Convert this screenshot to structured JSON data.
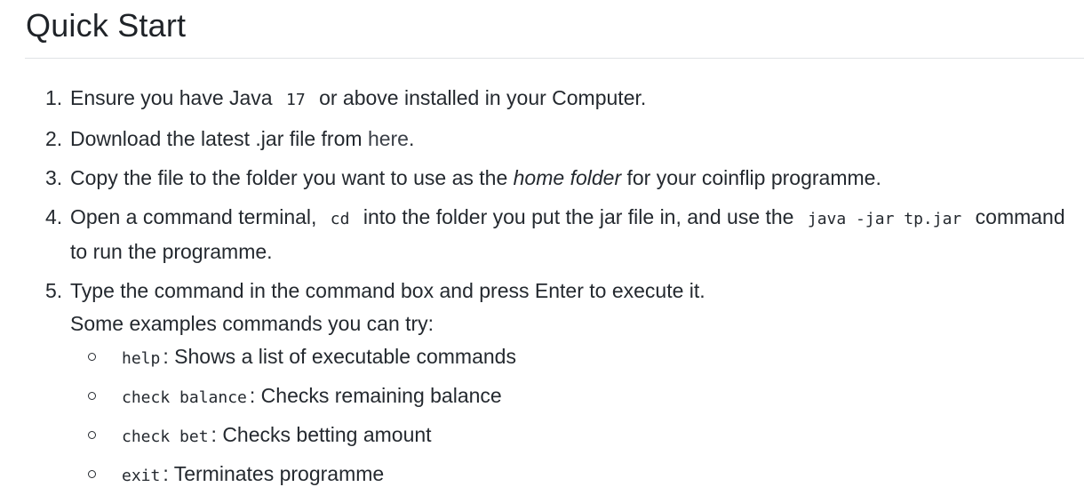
{
  "heading": "Quick Start",
  "steps": [
    {
      "num": "1.",
      "pre": "Ensure you have Java",
      "code": "17",
      "post": "or above installed in your Computer."
    },
    {
      "num": "2.",
      "pre": "Download the latest .jar file from",
      "link": "here",
      "post": "."
    },
    {
      "num": "3.",
      "pre": "Copy the file to the folder you want to use as the",
      "em": "home folder",
      "post": "for your coinflip programme."
    },
    {
      "num": "4.",
      "pre": "Open a command terminal,",
      "code1": "cd",
      "mid": "into the folder you put the jar file in, and use the",
      "code2": "java -jar tp.jar",
      "post": "command to run the programme."
    },
    {
      "num": "5.",
      "text": "Type the command in the command box and press Enter to execute it.",
      "subtext": "Some examples commands you can try:",
      "examples": [
        {
          "code": "help",
          "desc": ": Shows a list of executable commands"
        },
        {
          "code": "check balance",
          "desc": ": Checks remaining balance"
        },
        {
          "code": "check bet",
          "desc": ": Checks betting amount"
        },
        {
          "code": "exit",
          "desc": ": Terminates programme"
        }
      ]
    }
  ]
}
